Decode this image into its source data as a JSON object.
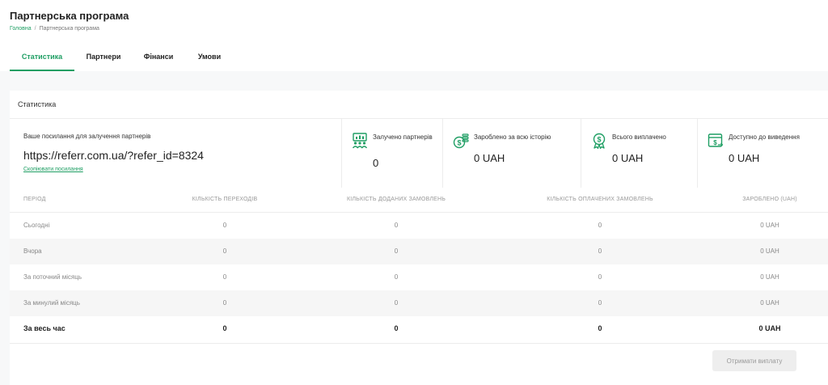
{
  "header": {
    "title": "Партнерська програма",
    "breadcrumb": {
      "home": "Головна",
      "separator": "/",
      "current": "Партнерська програма"
    }
  },
  "tabs": [
    {
      "label": "Статистика",
      "active": true
    },
    {
      "label": "Партнери",
      "active": false
    },
    {
      "label": "Фінанси",
      "active": false
    },
    {
      "label": "Умови",
      "active": false
    }
  ],
  "card": {
    "title": "Статистика",
    "referral": {
      "label": "Ваше посилання для залучення партнерів",
      "link": "https://referr.com.ua/?refer_id=8324",
      "copy_label": "Скопіювати посилання"
    },
    "stats": [
      {
        "label": "Залучено партнерів",
        "value": "0",
        "icon": "partners-icon"
      },
      {
        "label": "Зароблено за всю історію",
        "value": "0 UAH",
        "icon": "earnings-icon"
      },
      {
        "label": "Всього виплачено",
        "value": "0 UAH",
        "icon": "payout-award-icon"
      },
      {
        "label": "Доступно до виведення",
        "value": "0 UAH",
        "icon": "withdraw-icon"
      }
    ]
  },
  "table": {
    "headers": [
      "Період",
      "Кількість переходів",
      "Кількість доданих замовлень",
      "Кількість оплачених замовлень",
      "Зароблено (UAH)"
    ],
    "rows": [
      [
        "Сьогодні",
        "0",
        "0",
        "0",
        "0 UAH"
      ],
      [
        "Вчора",
        "0",
        "0",
        "0",
        "0 UAH"
      ],
      [
        "За поточний місяць",
        "0",
        "0",
        "0",
        "0 UAH"
      ],
      [
        "За минулий місяць",
        "0",
        "0",
        "0",
        "0 UAH"
      ]
    ],
    "total": [
      "За весь час",
      "0",
      "0",
      "0",
      "0 UAH"
    ]
  },
  "payout_button": "Отримати виплату",
  "colors": {
    "accent": "#1e9e63",
    "background": "#f7f8f9",
    "card": "#ffffff"
  }
}
